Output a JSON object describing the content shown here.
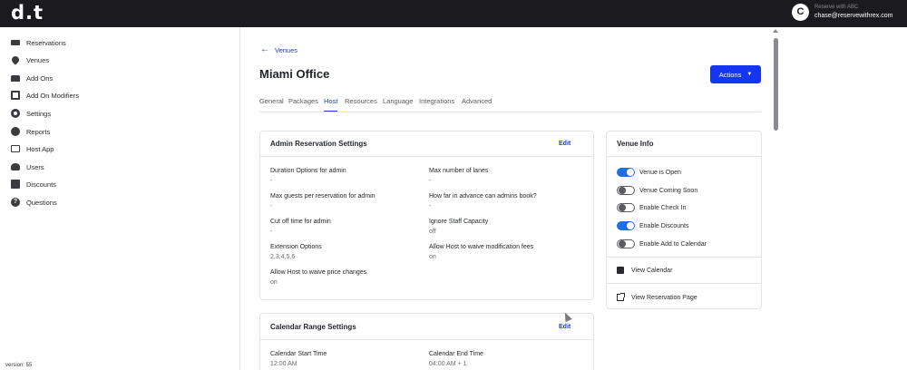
{
  "app": {
    "logo": "d.t",
    "user": {
      "initial": "C",
      "top_line": "Reserve with ABC",
      "email": "chase@reservewithrex.com"
    },
    "version": "version: 55"
  },
  "sidebar": {
    "items": [
      {
        "label": "Reservations",
        "icon": "ticket-icon"
      },
      {
        "label": "Venues",
        "icon": "map-pin-icon"
      },
      {
        "label": "Add Ons",
        "icon": "add-ons-icon"
      },
      {
        "label": "Add On Modifiers",
        "icon": "modifiers-icon"
      },
      {
        "label": "Settings",
        "icon": "gear-icon"
      },
      {
        "label": "Reports",
        "icon": "reports-icon"
      },
      {
        "label": "Host App",
        "icon": "monitor-icon"
      },
      {
        "label": "Users",
        "icon": "users-icon"
      },
      {
        "label": "Discounts",
        "icon": "discount-icon"
      },
      {
        "label": "Questions",
        "icon": "question-icon"
      }
    ]
  },
  "main": {
    "back_label": "Venues",
    "title": "Miami Office",
    "actions_label": "Actions",
    "tabs": [
      {
        "label": "General"
      },
      {
        "label": "Packages"
      },
      {
        "label": "Host",
        "active": true
      },
      {
        "label": "Resources"
      },
      {
        "label": "Language"
      },
      {
        "label": "Integrations"
      },
      {
        "label": "Advanced"
      }
    ],
    "admin_card": {
      "title": "Admin Reservation Settings",
      "edit": "Edit",
      "fields": [
        {
          "label": "Duration Options for admin",
          "value": "-"
        },
        {
          "label": "Max number of lanes",
          "value": "-"
        },
        {
          "label": "Max guests per reservation for admin",
          "value": "-"
        },
        {
          "label": "How far in advance can admins book?",
          "value": "-"
        },
        {
          "label": "Cut off time for admin",
          "value": "-"
        },
        {
          "label": "Ignore Staff Capacity",
          "value": "off"
        },
        {
          "label": "Extension Options",
          "value": "2,3,4,5,6"
        },
        {
          "label": "Allow Host to waive modification fees",
          "value": "on"
        },
        {
          "label": "Allow Host to waive price changes",
          "value": "on"
        }
      ]
    },
    "calendar_card": {
      "title": "Calendar Range Settings",
      "edit": "Edit",
      "fields": [
        {
          "label": "Calendar Start Time",
          "value": "12:00 AM"
        },
        {
          "label": "Calendar End Time",
          "value": "04:00 AM + 1"
        }
      ]
    },
    "venue_info": {
      "title": "Venue Info",
      "toggles": [
        {
          "label": "Venue is Open",
          "on": true
        },
        {
          "label": "Venue Coming Soon",
          "on": false
        },
        {
          "label": "Enable Check In",
          "on": false
        },
        {
          "label": "Enable Discounts",
          "on": true
        },
        {
          "label": "Enable Add to Calendar",
          "on": false
        }
      ],
      "links": [
        {
          "label": "View Calendar",
          "icon": "calendar-icon"
        },
        {
          "label": "View Reservation Page",
          "icon": "external-link-icon"
        }
      ]
    }
  },
  "colors": {
    "accent": "#1536f0",
    "toggle_on": "#1f6fe0",
    "topbar": "#1b1b1f"
  }
}
